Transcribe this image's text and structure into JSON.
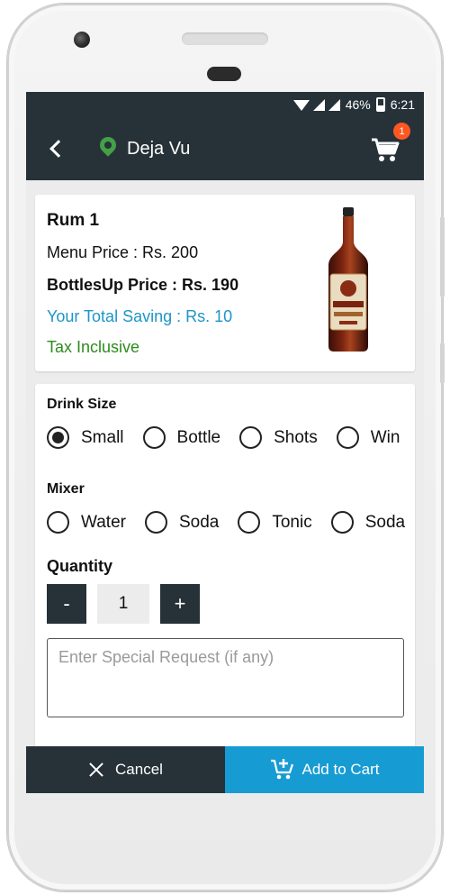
{
  "status": {
    "battery": "46%",
    "time": "6:21"
  },
  "header": {
    "title": "Deja Vu",
    "cart_count": "1"
  },
  "product": {
    "name": "Rum 1",
    "menu_price": "Menu Price : Rs. 200",
    "bottlesup_price": "BottlesUp Price : Rs. 190",
    "saving": "Your Total Saving : Rs. 10",
    "tax": "Tax Inclusive",
    "bottle_label": "Khukri XXX Rum"
  },
  "drink_size": {
    "label": "Drink Size",
    "options": [
      "Small",
      "Bottle",
      "Shots",
      "Win"
    ],
    "selected": "Small"
  },
  "mixer": {
    "label": "Mixer",
    "options": [
      "Water",
      "Soda",
      "Tonic",
      "Soda"
    ]
  },
  "quantity": {
    "label": "Quantity",
    "minus": "-",
    "value": "1",
    "plus": "+"
  },
  "special_request": {
    "placeholder": "Enter Special Request (if any)"
  },
  "footer": {
    "cancel": "Cancel",
    "add_to_cart": "Add to Cart"
  },
  "colors": {
    "appbar": "#263238",
    "accent_blue": "#179bd3",
    "saving_blue": "#1e95c8",
    "tax_green": "#2e8b1e",
    "badge": "#ff5722",
    "pin_green": "#43a047"
  }
}
